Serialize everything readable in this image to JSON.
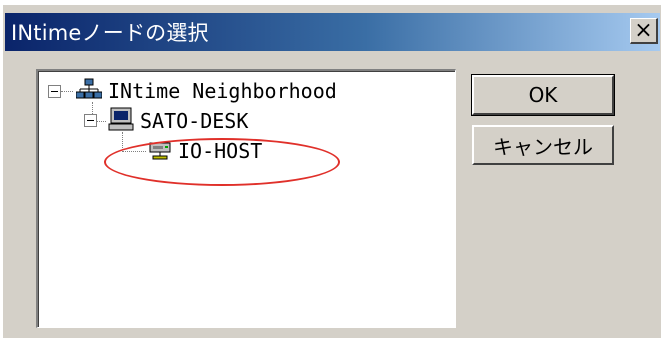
{
  "window": {
    "title": "INtimeノードの選択",
    "close_glyph": "×"
  },
  "tree": {
    "root": {
      "label": "INtime Neighborhood",
      "icon": "network-icon"
    },
    "child": {
      "label": "SATO-DESK",
      "icon": "computer-icon"
    },
    "grandchild": {
      "label": "IO-HOST",
      "icon": "server-icon"
    }
  },
  "buttons": {
    "ok": "OK",
    "cancel": "キャンセル"
  },
  "colors": {
    "title_start": "#0a246a",
    "title_end": "#a6caf0",
    "annotation": "#e0302a"
  }
}
